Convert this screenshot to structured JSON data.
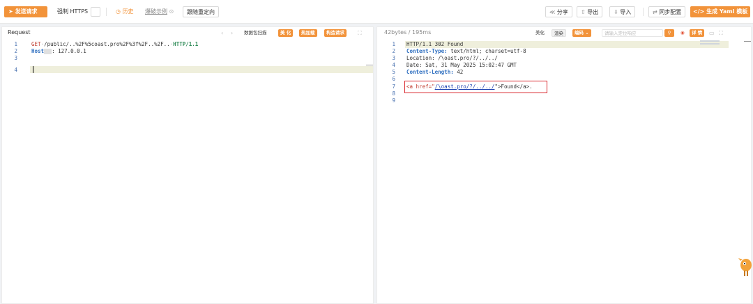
{
  "toolbar": {
    "send_label": "发送请求",
    "force_https_label": "强制 HTTPS",
    "history_label": "历史",
    "grab_example_label": "爆破示例",
    "follow_redirect_label": "跟随重定向",
    "share_label": "分享",
    "export_label": "导出",
    "import_label": "导入",
    "sync_label": "同步配置",
    "yaml_label": "生成 Yaml 模板"
  },
  "request": {
    "title": "Request",
    "scan_label": "数据包扫描",
    "beautify_label": "美 化",
    "hotload_label": "热加载",
    "build_label": "构造请求",
    "lines": [
      {
        "num": "1",
        "method": "GET",
        "path": "/public/..%2F%5coast.pro%2F%3f%2F..%2F..",
        "proto": "HTTP/1.1"
      },
      {
        "num": "2",
        "header": "Host",
        "value": ": 127.0.0.1"
      },
      {
        "num": "3"
      },
      {
        "num": "4"
      }
    ]
  },
  "response": {
    "meta": "42bytes / 195ms",
    "beautify_label": "美化",
    "render_label": "渲染",
    "encoding_label": "编码",
    "search_placeholder": "请输入定位响应",
    "detail_label": "详 情",
    "lines": [
      {
        "num": "1",
        "text": "HTTP/1.1 302 Found"
      },
      {
        "num": "2",
        "key": "Content-Type:",
        "value": " text/html; charset=utf-8"
      },
      {
        "num": "3",
        "text": "Location: /\\oast.pro/?/../../"
      },
      {
        "num": "4",
        "text": "Date: Sat, 31 May 2025 15:02:47 GMT"
      },
      {
        "num": "5",
        "key": "Content-Length:",
        "value": " 42"
      },
      {
        "num": "6"
      },
      {
        "num": "7",
        "html_open": "<a href=\"",
        "html_href": "/\\oast.pro/?/../../",
        "html_close": "\">Found</a>."
      },
      {
        "num": "8"
      },
      {
        "num": "9"
      }
    ]
  },
  "colors": {
    "accent": "#f2933a",
    "highlight_box": "#d9262c"
  }
}
